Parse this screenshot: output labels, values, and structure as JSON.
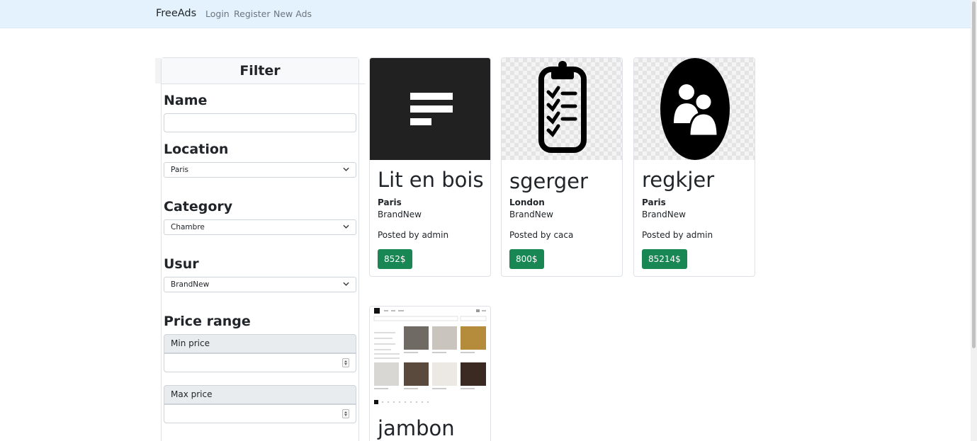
{
  "navbar": {
    "brand": "FreeAds",
    "links": [
      "Login",
      "Register",
      "New Ads"
    ]
  },
  "filter": {
    "title": "Filter",
    "name_label": "Name",
    "name_value": "",
    "location_label": "Location",
    "location_selected": "Paris",
    "category_label": "Category",
    "category_selected": "Chambre",
    "usur_label": "Usur",
    "usur_selected": "BrandNew",
    "price_label": "Price range",
    "min_label": "Min price",
    "max_label": "Max price"
  },
  "ads": [
    {
      "title": "Lit en bois",
      "location": "Paris",
      "condition": "BrandNew",
      "posted": "Posted by admin",
      "price": "852$",
      "icon": "text-lines-icon"
    },
    {
      "title": " sgerger",
      "location": "London",
      "condition": "BrandNew",
      "posted": "Posted by caca",
      "price": "800$",
      "icon": "checklist-clipboard-icon"
    },
    {
      "title": "regkjer",
      "location": "Paris",
      "condition": "BrandNew",
      "posted": "Posted by admin",
      "price": "85214$",
      "icon": "user-group-icon"
    },
    {
      "title": "jambon",
      "icon": "website-screenshot-thumbnail"
    }
  ],
  "colors": {
    "navbar_bg": "#e3f2fd",
    "price_btn": "#198754",
    "card_image_dark": "#212121"
  }
}
